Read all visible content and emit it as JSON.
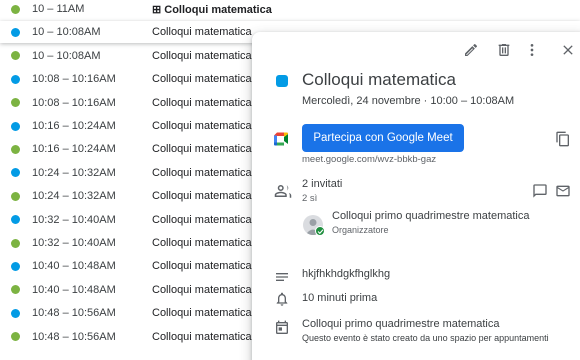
{
  "colors": {
    "green": "#7cb342",
    "blue": "#039be5",
    "event": "#039be5",
    "meet_button": "#1a73e8"
  },
  "schedule": [
    {
      "time": "10 – 11AM",
      "title": "⊞ Colloqui matematica",
      "color": "#7cb342",
      "bold": true
    },
    {
      "time": "10 – 10:08AM",
      "title": "Colloqui matematica",
      "color": "#039be5",
      "selected": true
    },
    {
      "time": "10 – 10:08AM",
      "title": "Colloqui matematica",
      "color": "#7cb342"
    },
    {
      "time": "10:08 – 10:16AM",
      "title": "Colloqui matematica",
      "color": "#039be5"
    },
    {
      "time": "10:08 – 10:16AM",
      "title": "Colloqui matematica",
      "color": "#7cb342"
    },
    {
      "time": "10:16 – 10:24AM",
      "title": "Colloqui matematica",
      "color": "#039be5"
    },
    {
      "time": "10:16 – 10:24AM",
      "title": "Colloqui matematica",
      "color": "#7cb342"
    },
    {
      "time": "10:24 – 10:32AM",
      "title": "Colloqui matematica",
      "color": "#039be5"
    },
    {
      "time": "10:24 – 10:32AM",
      "title": "Colloqui matematica",
      "color": "#7cb342"
    },
    {
      "time": "10:32 – 10:40AM",
      "title": "Colloqui matematica",
      "color": "#039be5"
    },
    {
      "time": "10:32 – 10:40AM",
      "title": "Colloqui matematica",
      "color": "#7cb342"
    },
    {
      "time": "10:40 – 10:48AM",
      "title": "Colloqui matematica",
      "color": "#039be5"
    },
    {
      "time": "10:40 – 10:48AM",
      "title": "Colloqui matematica",
      "color": "#7cb342"
    },
    {
      "time": "10:48 – 10:56AM",
      "title": "Colloqui matematica",
      "color": "#039be5"
    },
    {
      "time": "10:48 – 10:56AM",
      "title": "Colloqui matematica",
      "color": "#7cb342"
    }
  ],
  "popup": {
    "toolbar_icons": [
      "edit-icon",
      "delete-icon",
      "more-options-icon",
      "close-icon"
    ],
    "title": "Colloqui matematica",
    "date_time": "Mercoledì, 24 novembre  ·  10:00 – 10:08AM",
    "meet_button": "Partecipa con Google Meet",
    "meet_link": "meet.google.com/wvz-bbkb-gaz",
    "guests_count": "2 invitati",
    "guests_yes": "2 sì",
    "organizer_name": "Colloqui primo quadrimestre matematica",
    "organizer_role": "Organizzatore",
    "description": "hkjfhkhdgkfhglkhg",
    "reminder": "10 minuti prima",
    "calendar_name": "Colloqui primo quadrimestre matematica",
    "calendar_note": "Questo evento è stato creato da uno spazio per appuntamenti"
  }
}
